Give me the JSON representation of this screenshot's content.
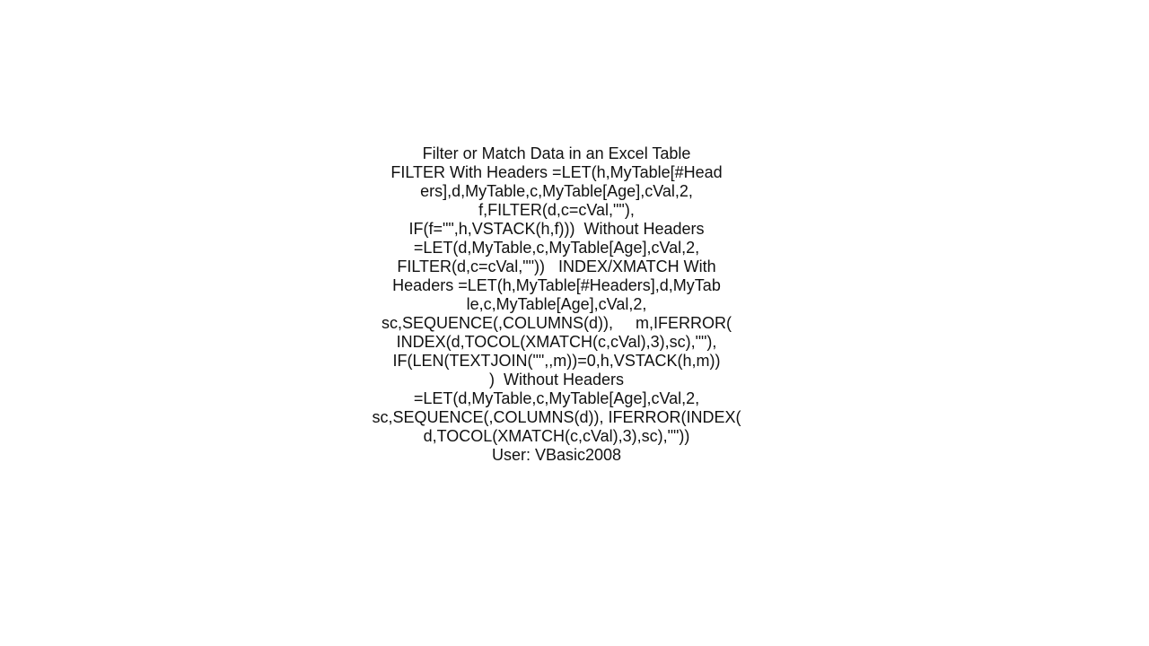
{
  "document": {
    "title": "Filter or Match Data in an Excel Table",
    "lines": [
      "FILTER With Headers =LET(h,MyTable[#Head",
      "ers],d,MyTable,c,MyTable[Age],cVal,2,",
      "f,FILTER(d,c=cVal,\"\"),",
      "IF(f=\"\",h,VSTACK(h,f)))  Without Headers",
      "=LET(d,MyTable,c,MyTable[Age],cVal,2,",
      "FILTER(d,c=cVal,\"\"))   INDEX/XMATCH With",
      "Headers =LET(h,MyTable[#Headers],d,MyTab",
      "le,c,MyTable[Age],cVal,2,",
      "sc,SEQUENCE(,COLUMNS(d)),     m,IFERROR(",
      "INDEX(d,TOCOL(XMATCH(c,cVal),3),sc),\"\"),",
      "IF(LEN(TEXTJOIN(\"\",,m))=0,h,VSTACK(h,m))",
      ")  Without Headers",
      "=LET(d,MyTable,c,MyTable[Age],cVal,2,",
      "sc,SEQUENCE(,COLUMNS(d)), IFERROR(INDEX(",
      "d,TOCOL(XMATCH(c,cVal),3),sc),\"\"))"
    ],
    "user": "User: VBasic2008"
  }
}
